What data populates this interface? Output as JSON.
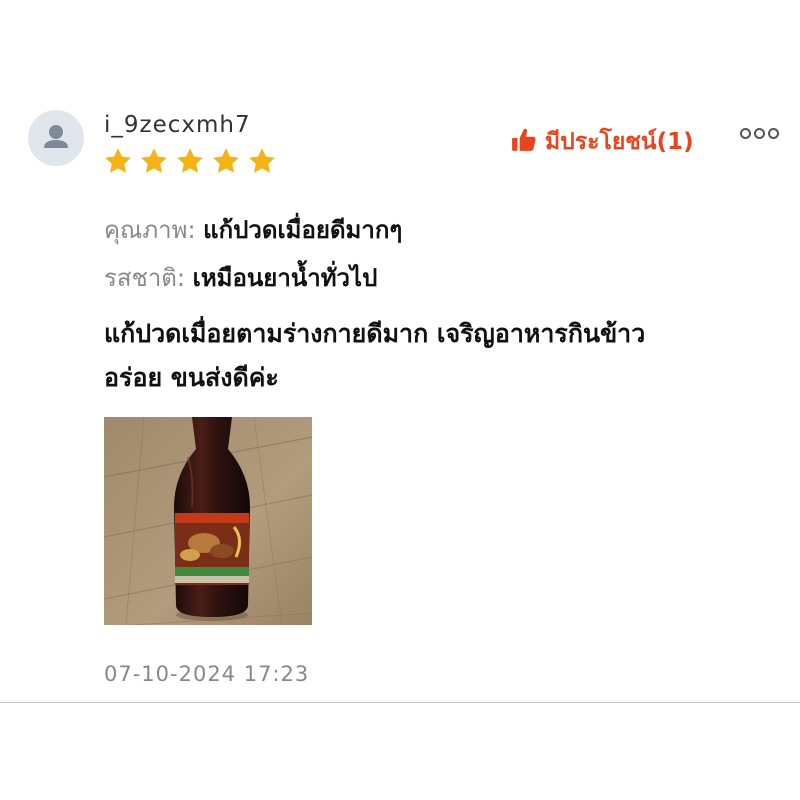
{
  "review": {
    "username": "i_9zecxmh7",
    "rating": 5,
    "max_rating": 5,
    "helpful_label": "มีประโยชน์(1)",
    "attributes": [
      {
        "label": "คุณภาพ:",
        "value": "แก้ปวดเมื่อยดีมากๆ"
      },
      {
        "label": "รสชาติ:",
        "value": "เหมือนยาน้ำทั่วไป"
      }
    ],
    "body_lines": [
      "แก้ปวดเมื่อยตามร่างกายดีมาก เจริญอาหารกินข้าว",
      "อร่อย ขนส่งดีค่ะ"
    ],
    "timestamp": "07-10-2024 17:23"
  },
  "icons": {
    "avatar": "user-avatar-icon",
    "star": "star-icon",
    "thumb": "thumbs-up-icon",
    "more": "more-options-icon"
  },
  "colors": {
    "accent": "#e8451e",
    "star": "#f5b316",
    "muted": "#888888",
    "avatar_bg": "#dfe6ec"
  }
}
